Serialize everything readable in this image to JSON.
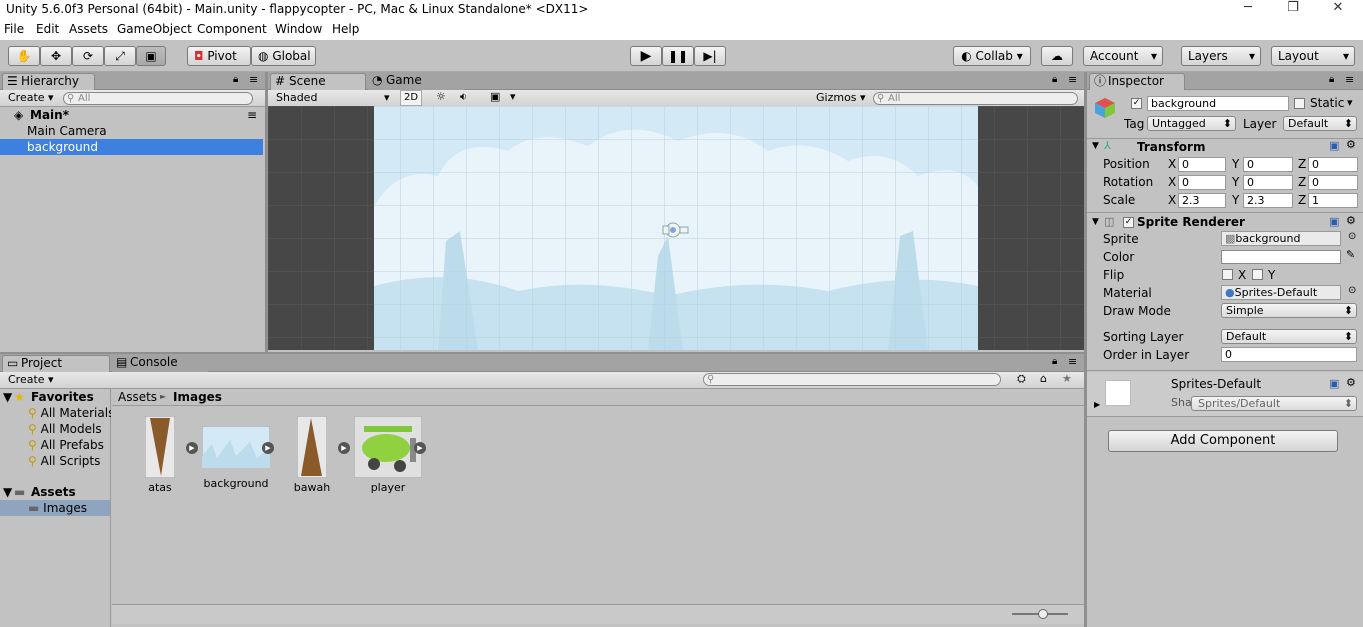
{
  "window": {
    "title": "Unity 5.6.0f3 Personal (64bit) - Main.unity - flappycopter - PC, Mac & Linux Standalone* <DX11>",
    "min": "─",
    "max": "❐",
    "close": "✕"
  },
  "menu": [
    "File",
    "Edit",
    "Assets",
    "GameObject",
    "Component",
    "Window",
    "Help"
  ],
  "toolbar": {
    "pivot": "Pivot",
    "global": "Global",
    "collab": "Collab ▾",
    "account": "Account",
    "layers": "Layers",
    "layout": "Layout"
  },
  "hierarchy": {
    "tab": "Hierarchy",
    "create": "Create ▾",
    "search_placeholder": "All",
    "scene": "Main*",
    "items": [
      "Main Camera",
      "background"
    ]
  },
  "scene": {
    "tab_scene": "Scene",
    "tab_game": "Game",
    "shading": "Shaded",
    "mode2d": "2D",
    "gizmos": "Gizmos",
    "search_placeholder": "All"
  },
  "project": {
    "tab_project": "Project",
    "tab_console": "Console",
    "create": "Create ▾",
    "favorites_label": "Favorites",
    "favorites": [
      "All Materials",
      "All Models",
      "All Prefabs",
      "All Scripts"
    ],
    "assets_label": "Assets",
    "images_label": "Images",
    "breadcrumb_root": "Assets",
    "breadcrumb_sep": "►",
    "breadcrumb_current": "Images",
    "assets": [
      "atas",
      "background",
      "bawah",
      "player"
    ]
  },
  "inspector": {
    "tab": "Inspector",
    "object_name": "background",
    "static": "Static",
    "tag_label": "Tag",
    "tag": "Untagged",
    "layer_label": "Layer",
    "layer": "Default",
    "transform": {
      "title": "Transform",
      "position_label": "Position",
      "rotation_label": "Rotation",
      "scale_label": "Scale",
      "position": [
        "0",
        "0",
        "0"
      ],
      "rotation": [
        "0",
        "0",
        "0"
      ],
      "scale": [
        "2.3",
        "2.3",
        "1"
      ],
      "axes": [
        "X",
        "Y",
        "Z"
      ]
    },
    "sprite_renderer": {
      "title": "Sprite Renderer",
      "sprite_label": "Sprite",
      "sprite": "background",
      "color_label": "Color",
      "flip_label": "Flip",
      "flip_x": "X",
      "flip_y": "Y",
      "material_label": "Material",
      "material": "Sprites-Default",
      "draw_mode_label": "Draw Mode",
      "draw_mode": "Simple",
      "sorting_layer_label": "Sorting Layer",
      "sorting_layer": "Default",
      "order_label": "Order in Layer",
      "order": "0"
    },
    "material_block": {
      "name": "Sprites-Default",
      "shader_label": "Shader",
      "shader": "Sprites/Default"
    },
    "add_component": "Add Component"
  },
  "colors": {
    "selection": "#3d80df",
    "sky": "#d3e9f5",
    "scene_bg": "#474747"
  }
}
